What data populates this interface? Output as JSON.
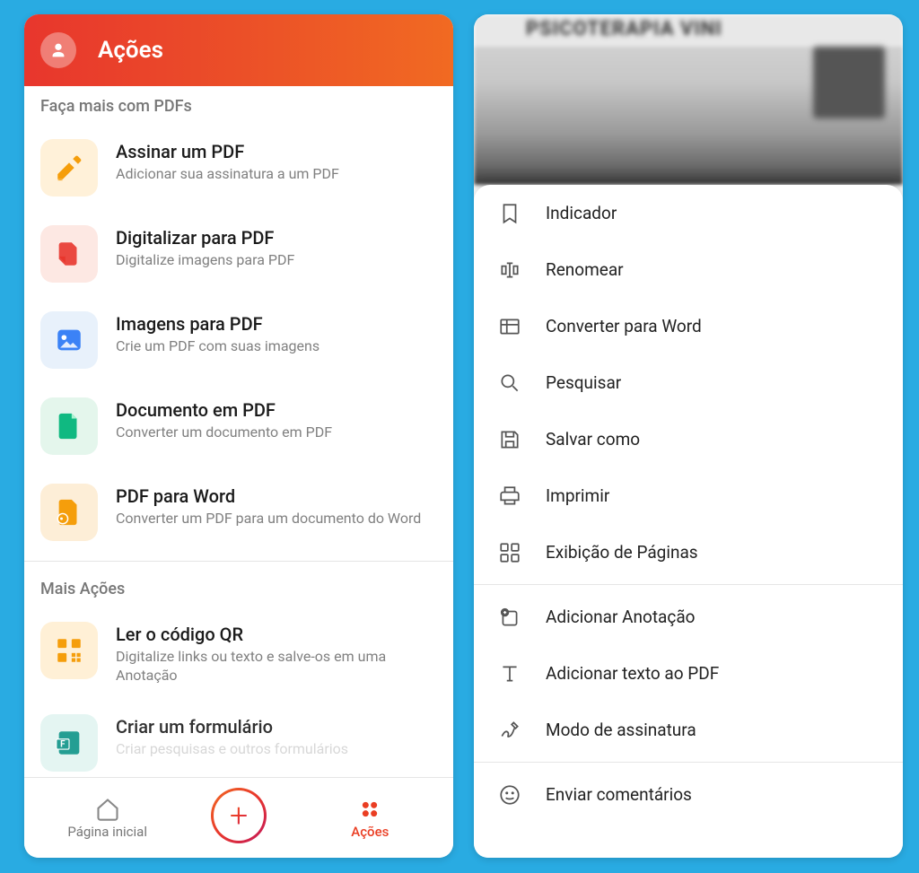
{
  "left": {
    "header_title": "Ações",
    "section1_label": "Faça mais com PDFs",
    "actions1": [
      {
        "title": "Assinar um PDF",
        "sub": "Adicionar sua assinatura a um PDF"
      },
      {
        "title": "Digitalizar para PDF",
        "sub": "Digitalize imagens para PDF"
      },
      {
        "title": "Imagens para PDF",
        "sub": "Crie um PDF com suas imagens"
      },
      {
        "title": "Documento em PDF",
        "sub": "Converter um documento em PDF"
      },
      {
        "title": "PDF para Word",
        "sub": "Converter um PDF para um documento do Word"
      }
    ],
    "section2_label": "Mais Ações",
    "actions2": [
      {
        "title": "Ler o código QR",
        "sub": "Digitalize links ou texto e salve-os em uma Anotação"
      },
      {
        "title": "Criar um formulário",
        "sub": "Criar pesquisas e outros formulários"
      }
    ],
    "nav": {
      "home": "Página inicial",
      "actions": "Ações"
    },
    "blur_title": "PSICOTERAPIA  VINI"
  },
  "right": {
    "menu": [
      "Indicador",
      "Renomear",
      "Converter para Word",
      "Pesquisar",
      "Salvar como",
      "Imprimir",
      "Exibição de Páginas",
      "Adicionar Anotação",
      "Adicionar texto ao PDF",
      "Modo de assinatura",
      "Enviar comentários"
    ]
  }
}
